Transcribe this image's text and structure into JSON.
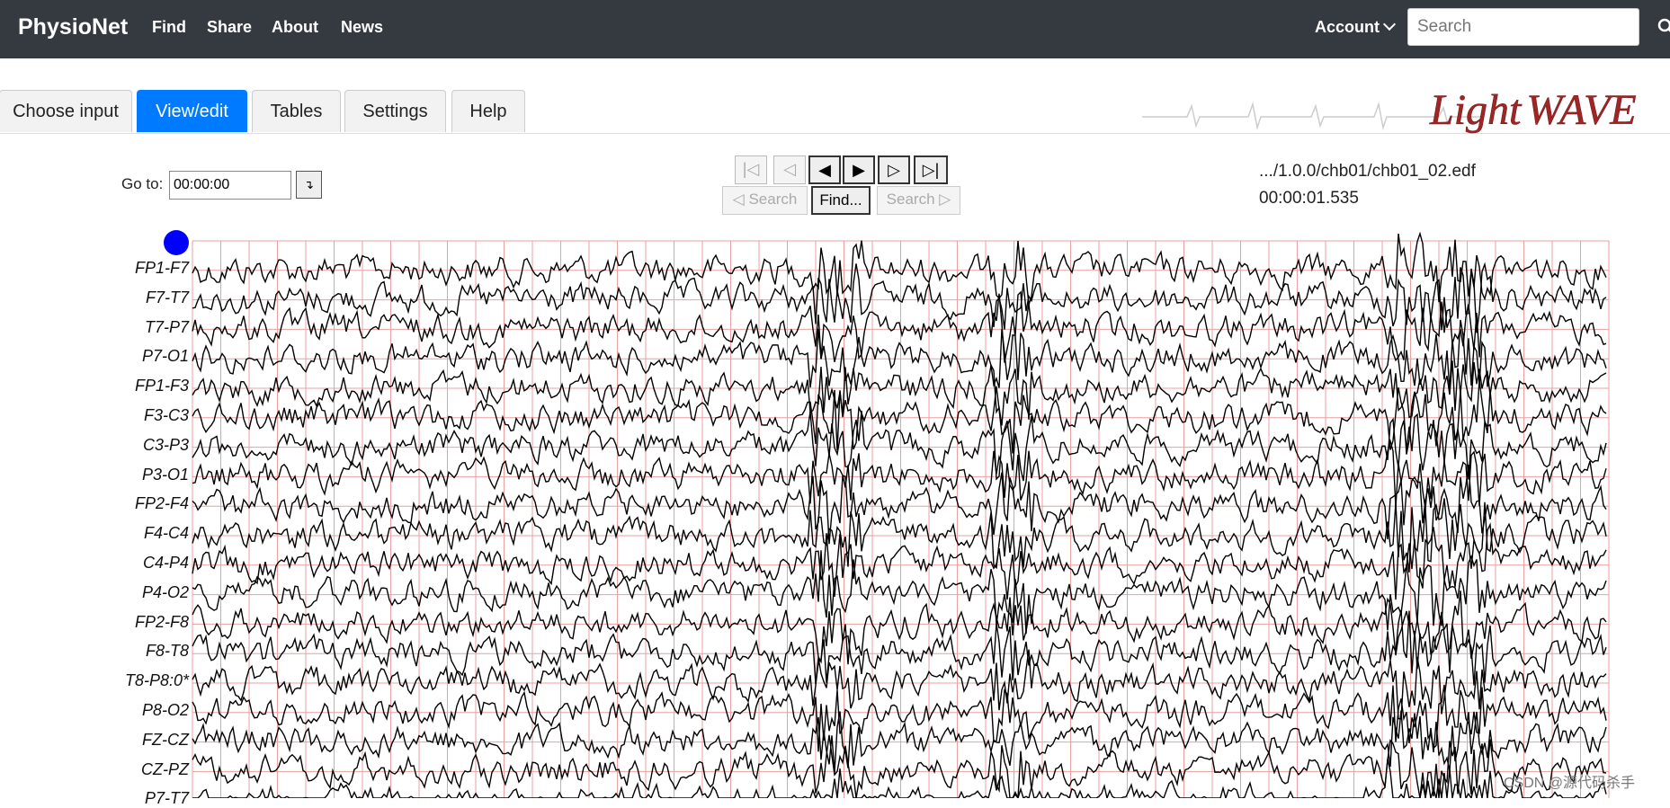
{
  "nav": {
    "brand": "PhysioNet",
    "links": [
      "Find",
      "Share",
      "About",
      "News"
    ],
    "account": "Account",
    "search_placeholder": "Search"
  },
  "tabs": [
    "Choose input",
    "View/edit",
    "Tables",
    "Settings",
    "Help"
  ],
  "active_tab": "View/edit",
  "logo": {
    "part1": "Light",
    "part2": "WAVE"
  },
  "controls": {
    "goto_label": "Go to:",
    "goto_value": "00:00:00",
    "goto_button": "↴",
    "nav_buttons": [
      "|◁",
      "◁",
      "◀",
      "▶",
      "▷",
      "▷|"
    ],
    "search_back": "◁ Search",
    "find": "Find...",
    "search_forward": "Search ▷"
  },
  "record": {
    "path": ".../1.0.0/chb01/chb01_02.edf",
    "time": "00:00:01.535"
  },
  "signals": [
    "FP1-F7",
    "F7-T7",
    "T7-P7",
    "P7-O1",
    "FP1-F3",
    "F3-C3",
    "C3-P3",
    "P3-O1",
    "FP2-F4",
    "F4-C4",
    "C4-P4",
    "P4-O2",
    "FP2-F8",
    "F8-T8",
    "T8-P8:0*",
    "P8-O2",
    "FZ-CZ",
    "CZ-PZ",
    "P7-T7"
  ],
  "watermark": "CSDN @源代码杀手",
  "colors": {
    "navbar": "#343a40",
    "active_tab": "#007bff",
    "grid": "#e8a0a0",
    "trace": "#000000",
    "marker": "#0000ff",
    "logo": "#9b1b1b"
  }
}
